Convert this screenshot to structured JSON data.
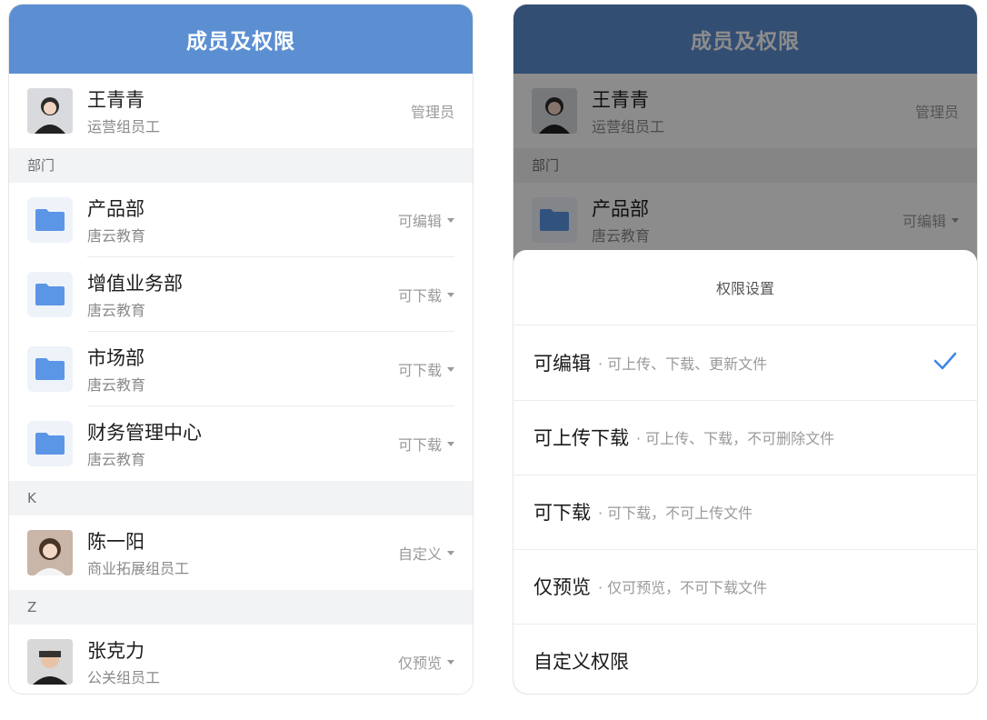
{
  "left": {
    "header": "成员及权限",
    "admin": {
      "name": "王青青",
      "sub": "运营组员工",
      "role": "管理员"
    },
    "sections": {
      "dept": "部门",
      "k": "K",
      "z": "Z"
    },
    "departments": [
      {
        "name": "产品部",
        "sub": "唐云教育",
        "perm": "可编辑"
      },
      {
        "name": "增值业务部",
        "sub": "唐云教育",
        "perm": "可下载"
      },
      {
        "name": "市场部",
        "sub": "唐云教育",
        "perm": "可下载"
      },
      {
        "name": "财务管理中心",
        "sub": "唐云教育",
        "perm": "可下载"
      }
    ],
    "members": [
      {
        "name": "陈一阳",
        "sub": "商业拓展组员工",
        "perm": "自定义"
      },
      {
        "name": "张克力",
        "sub": "公关组员工",
        "perm": "仅预览"
      }
    ]
  },
  "right": {
    "header": "成员及权限",
    "admin": {
      "name": "王青青",
      "sub": "运营组员工",
      "role": "管理员"
    },
    "section": "部门",
    "dept": {
      "name": "产品部",
      "sub": "唐云教育",
      "perm": "可编辑"
    },
    "sheet": {
      "title": "权限设置",
      "options": [
        {
          "name": "可编辑",
          "desc": "· 可上传、下载、更新文件",
          "selected": true
        },
        {
          "name": "可上传下载",
          "desc": "· 可上传、下载，不可删除文件",
          "selected": false
        },
        {
          "name": "可下载",
          "desc": "· 可下载，不可上传文件",
          "selected": false
        },
        {
          "name": "仅预览",
          "desc": "· 仅可预览，不可下载文件",
          "selected": false
        },
        {
          "name": "自定义权限",
          "desc": "",
          "selected": false
        }
      ]
    }
  },
  "colors": {
    "header": "#5b8fd2",
    "folder": "#5b95e6",
    "check": "#3d86e8"
  }
}
